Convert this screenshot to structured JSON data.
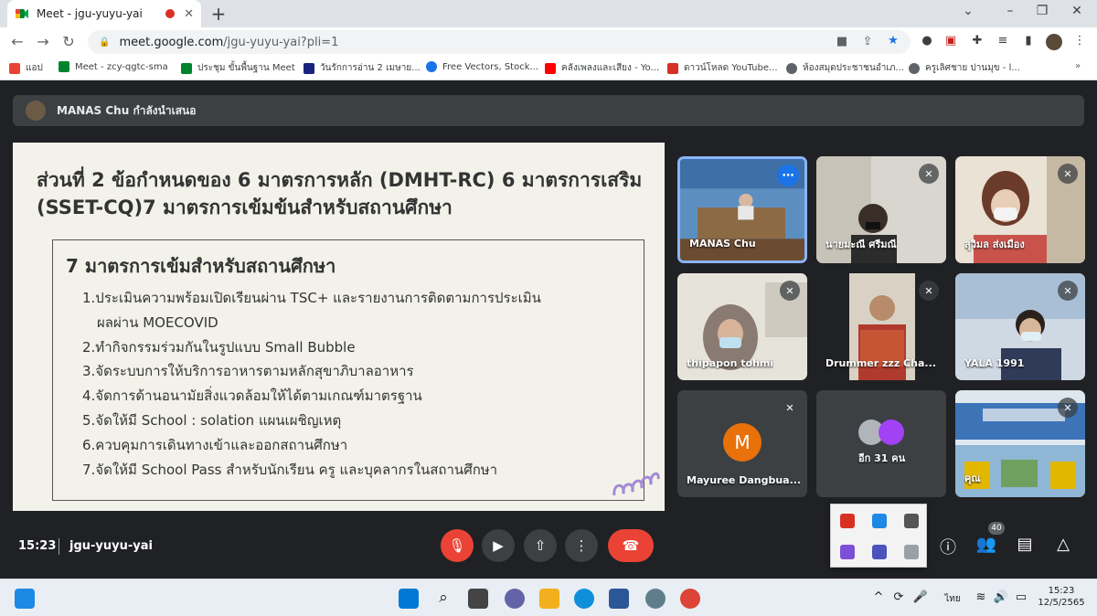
{
  "browser": {
    "tab_title": "Meet - jgu-yuyu-yai",
    "url_host": "meet.google.com",
    "url_path": "/jgu-yuyu-yai?pli=1",
    "bookmarks": [
      "แอป",
      "Meet - zcy-qgtc-sma",
      "ประชุม ขั้นพื้นฐาน Meet",
      "วันรักการอ่าน 2 เมษาย...",
      "Free Vectors, Stock...",
      "คลังเพลงและเสียง - Yo...",
      "ดาวน์โหลด YouTube...",
      "ห้องสมุดประชาชนอำเภ...",
      "ครูเลิศชาย ปานมุข - l..."
    ]
  },
  "meet": {
    "presenter_banner": "MANAS Chu กำลังนำเสนอ",
    "slide": {
      "title": "ส่วนที่ 2 ข้อกำหนดของ 6 มาตรการหลัก (DMHT-RC) 6 มาตรการเสริม (SSET-CQ)7 มาตรการเข้มข้นสำหรับสถานศึกษา",
      "box_heading": "7 มาตรการเข้มสำหรับสถานศึกษา",
      "items": [
        "1.ประเมินความพร้อมเปิดเรียนผ่าน TSC+ และรายงานการติดตามการประเมิน",
        "ผลผ่าน MOECOVID",
        "2.ทำกิจกรรมร่วมกันในรูปแบบ Small Bubble",
        "3.จัดระบบการให้บริการอาหารตามหลักสุขาภิบาลอาหาร",
        "4.จัดการด้านอนามัยสิ่งแวดล้อมให้ได้ตามเกณฑ์มาตรฐาน",
        "5.จัดให้มี School : solation แผนเผชิญเหตุ",
        "6.ควบคุมการเดินทางเข้าและออกสถานศึกษา",
        "7.จัดให้มี School Pass สำหรับนักเรียน ครู และบุคลากรในสถานศึกษา"
      ]
    },
    "participants": [
      "MANAS Chu",
      "นายมะณี ศรีมณี",
      "สุวิมล ส่งเมือง",
      "thipapon tohmi",
      "Drummer zzz Cha...",
      "YALA 1991",
      "Mayuree Dangbua...",
      "อีก 31 คน",
      "คุณ"
    ],
    "avatar_initial": "M",
    "time": "15:23",
    "meeting_code": "jgu-yuyu-yai",
    "participant_count": "40"
  },
  "taskbar": {
    "lang": "ไทย",
    "time": "15:23",
    "date": "12/5/2565"
  },
  "colors": {
    "meet_bg": "#202124",
    "end_call": "#ea4335",
    "active_tile": "#8ab4f8",
    "avatar_orange": "#e8710a"
  }
}
